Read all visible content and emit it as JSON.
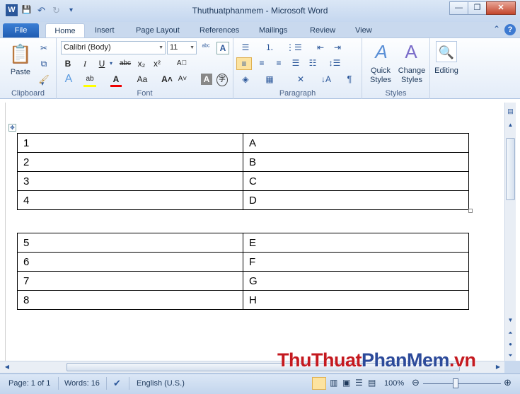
{
  "window": {
    "title": "Thuthuatphanmem - Microsoft Word"
  },
  "qat": {
    "word_icon": "W",
    "save_icon": "💾",
    "undo_icon": "↶",
    "redo_icon": "↻",
    "more_icon": "▾"
  },
  "window_controls": {
    "minimize": "—",
    "restore": "❐",
    "close": "✕"
  },
  "tabs": [
    {
      "label": "File"
    },
    {
      "label": "Home"
    },
    {
      "label": "Insert"
    },
    {
      "label": "Page Layout"
    },
    {
      "label": "References"
    },
    {
      "label": "Mailings"
    },
    {
      "label": "Review"
    },
    {
      "label": "View"
    }
  ],
  "ribbon": {
    "clipboard": {
      "label": "Clipboard",
      "paste": "Paste"
    },
    "font": {
      "label": "Font",
      "font_name": "Calibri (Body)",
      "font_size": "11"
    },
    "paragraph": {
      "label": "Paragraph"
    },
    "styles": {
      "label": "Styles",
      "quick_styles": "Quick Styles",
      "change_styles": "Change Styles"
    },
    "editing": {
      "label": "Editing"
    }
  },
  "table1": [
    [
      "1",
      "A"
    ],
    [
      "2",
      "B"
    ],
    [
      "3",
      "C"
    ],
    [
      "4",
      "D"
    ]
  ],
  "table2": [
    [
      "5",
      "E"
    ],
    [
      "6",
      "F"
    ],
    [
      "7",
      "G"
    ],
    [
      "8",
      "H"
    ]
  ],
  "status": {
    "page": "Page: 1 of 1",
    "words": "Words: 16",
    "language": "English (U.S.)",
    "zoom": "100%"
  },
  "watermark": {
    "part1": "ThuThuat",
    "part2": "PhanMem",
    "part3": ".vn"
  }
}
